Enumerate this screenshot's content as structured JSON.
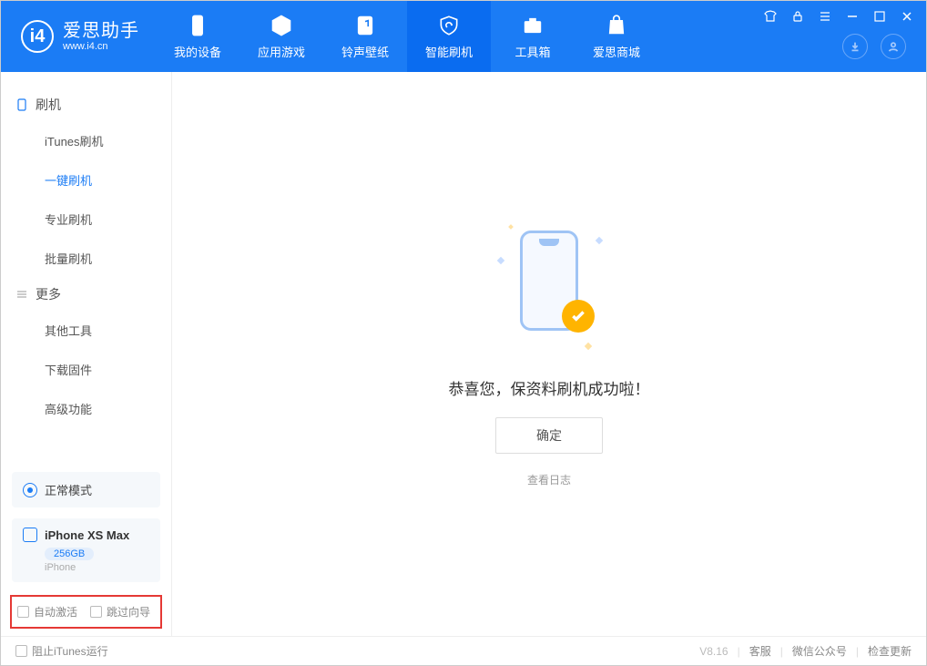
{
  "app": {
    "title": "爱思助手",
    "url": "www.i4.cn"
  },
  "tabs": [
    {
      "label": "我的设备"
    },
    {
      "label": "应用游戏"
    },
    {
      "label": "铃声壁纸"
    },
    {
      "label": "智能刷机"
    },
    {
      "label": "工具箱"
    },
    {
      "label": "爱思商城"
    }
  ],
  "sidebar": {
    "group1_title": "刷机",
    "items1": [
      {
        "label": "iTunes刷机"
      },
      {
        "label": "一键刷机"
      },
      {
        "label": "专业刷机"
      },
      {
        "label": "批量刷机"
      }
    ],
    "group2_title": "更多",
    "items2": [
      {
        "label": "其他工具"
      },
      {
        "label": "下载固件"
      },
      {
        "label": "高级功能"
      }
    ],
    "mode_card": "正常模式",
    "device": {
      "name": "iPhone XS Max",
      "capacity": "256GB",
      "type": "iPhone"
    },
    "chk_auto": "自动激活",
    "chk_skip": "跳过向导"
  },
  "main": {
    "message": "恭喜您，保资料刷机成功啦！",
    "ok": "确定",
    "log": "查看日志"
  },
  "footer": {
    "block_itunes": "阻止iTunes运行",
    "version": "V8.16",
    "link1": "客服",
    "link2": "微信公众号",
    "link3": "检查更新"
  }
}
